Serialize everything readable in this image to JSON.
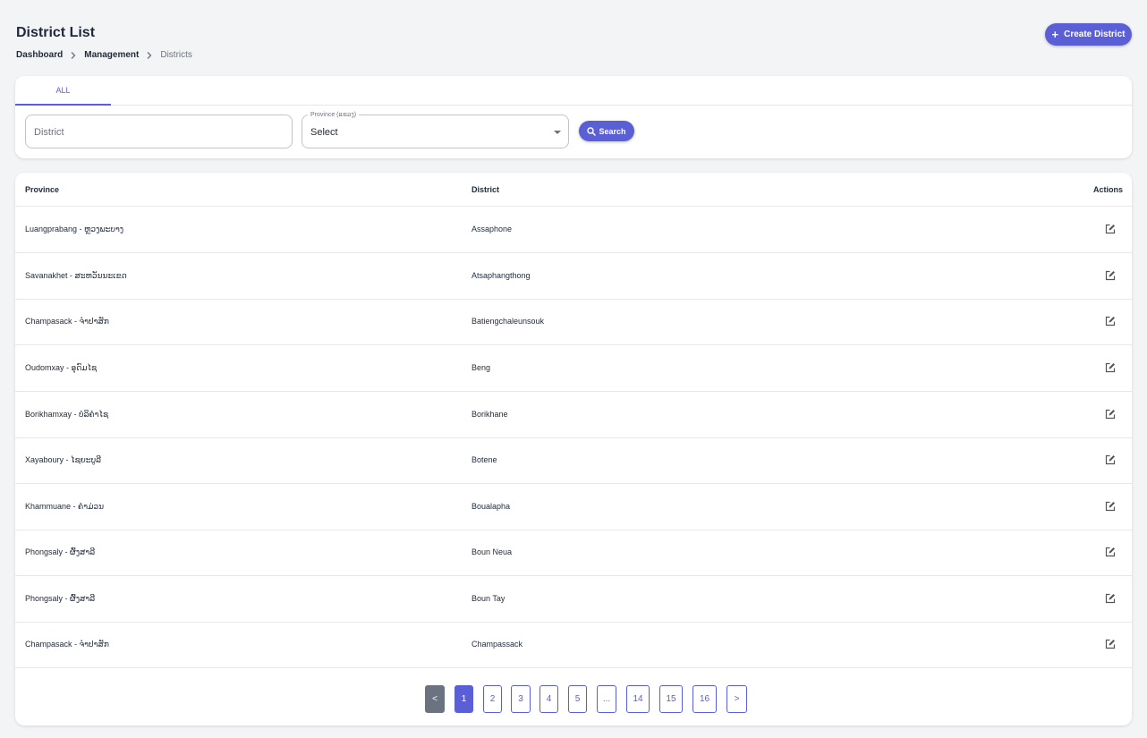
{
  "header": {
    "title": "District List",
    "breadcrumb": [
      "Dashboard",
      "Management",
      "Districts"
    ],
    "create_button": "Create District"
  },
  "filters": {
    "tabs": [
      "ALL"
    ],
    "district_placeholder": "District",
    "province_label": "Province (ແຂວງ)",
    "province_value": "Select",
    "search_button": "Search"
  },
  "table": {
    "columns": [
      "Province",
      "District",
      "Actions"
    ],
    "rows": [
      {
        "province": "Luangprabang - ຫຼວງພະບາງ",
        "district": "Assaphone"
      },
      {
        "province": "Savanakhet - ສະຫວັນນະເຂດ",
        "district": "Atsaphangthong"
      },
      {
        "province": "Champasack - ຈຳປາສັກ",
        "district": "Batiengchaleunsouk"
      },
      {
        "province": "Oudomxay - ອຸດົມໄຊ",
        "district": "Beng"
      },
      {
        "province": "Borikhamxay - ບໍລິຄຳໄຊ",
        "district": "Borikhane"
      },
      {
        "province": "Xayaboury - ໄຊຍະບູລີ",
        "district": "Botene"
      },
      {
        "province": "Khammuane - ຄຳມ່ວນ",
        "district": "Boualapha"
      },
      {
        "province": "Phongsaly - ຜົ້ງສາລີ",
        "district": "Boun Neua"
      },
      {
        "province": "Phongsaly - ຜົ້ງສາລີ",
        "district": "Boun Tay"
      },
      {
        "province": "Champasack - ຈຳປາສັກ",
        "district": "Champassack"
      }
    ]
  },
  "pagination": {
    "prev": "<",
    "pages": [
      "1",
      "2",
      "3",
      "4",
      "5",
      "...",
      "14",
      "15",
      "16"
    ],
    "next": ">",
    "current": "1"
  },
  "colors": {
    "accent": "#5b5fd6",
    "background": "#f3f4f6"
  },
  "icons": {
    "create": "plus-icon",
    "search": "search-icon",
    "edit": "edit-icon",
    "breadcrumb_separator": "chevron-right-icon",
    "select_caret": "caret-down-icon"
  }
}
